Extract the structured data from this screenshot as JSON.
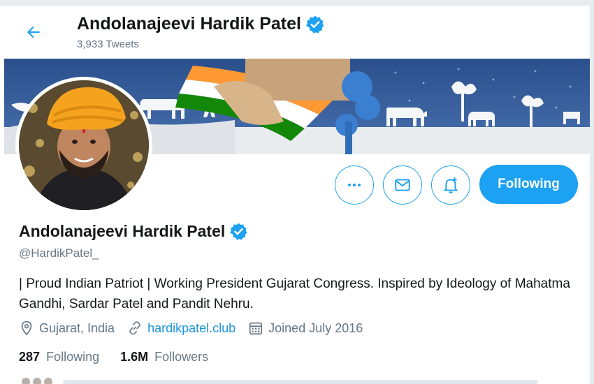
{
  "header": {
    "title": "Andolanajeevi Hardik Patel",
    "tweet_count": "3,933 Tweets"
  },
  "profile": {
    "display_name": "Andolanajeevi Hardik Patel",
    "handle": "@HardikPatel_",
    "bio": "| Proud Indian Patriot | Working President Gujarat Congress. Inspired by Ideology of Mahatma Gandhi, Sardar Patel and Pandit Nehru.",
    "location": "Gujarat, India",
    "website": "hardikpatel.club",
    "joined": "Joined July 2016"
  },
  "actions": {
    "follow_label": "Following"
  },
  "stats": {
    "following_count": "287",
    "following_label": "Following",
    "followers_count": "1.6M",
    "followers_label": "Followers"
  },
  "colors": {
    "accent": "#1da1f2",
    "link": "#1b95e0",
    "muted": "#657786",
    "text": "#14171a"
  }
}
